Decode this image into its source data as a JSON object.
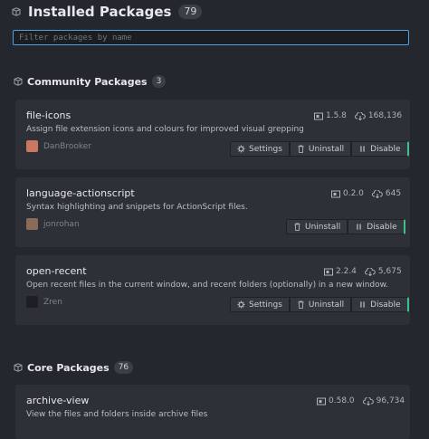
{
  "installed": {
    "title": "Installed Packages",
    "count": "79"
  },
  "filter": {
    "placeholder": "Filter packages by name",
    "value": ""
  },
  "community": {
    "title": "Community Packages",
    "count": "3"
  },
  "core": {
    "title": "Core Packages",
    "count": "76"
  },
  "buttons": {
    "settings": "Settings",
    "uninstall": "Uninstall",
    "disable": "Disable"
  },
  "packages": [
    {
      "name": "file-icons",
      "description": "Assign file extension icons and colours for improved visual grepping",
      "version": "1.5.8",
      "downloads": "168,136",
      "author": "DanBrooker",
      "avatar_color": "#c9785f"
    },
    {
      "name": "language-actionscript",
      "description": "Syntax highlighting and snippets for ActionScript files.",
      "version": "0.2.0",
      "downloads": "645",
      "author": "jonrohan",
      "avatar_color": "#8a6b5a"
    },
    {
      "name": "open-recent",
      "description": "Open recent files in the current window, and recent folders (optionally) in a new window.",
      "version": "2.2.4",
      "downloads": "5,675",
      "author": "Zren",
      "avatar_color": "#1d1f22"
    },
    {
      "name": "archive-view",
      "description": "View the files and folders inside archive files",
      "version": "0.58.0",
      "downloads": "96,734"
    }
  ],
  "icons": {
    "section": "package-icon",
    "version": "tag-icon",
    "downloads": "cloud-download-icon",
    "settings": "gear-icon",
    "uninstall": "trash-icon",
    "disable": "pause-icon"
  }
}
